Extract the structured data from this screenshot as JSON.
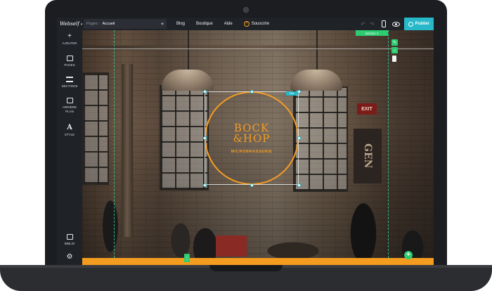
{
  "topbar": {
    "logo": "Webself",
    "pages_label": "Pages :",
    "pages_value": "Accueil",
    "nav": [
      "Blog",
      "Boutique",
      "Aide"
    ],
    "subscribe": "Souscrire",
    "publish": "Publier"
  },
  "sidebar": {
    "items": [
      {
        "label": "AJOUTER",
        "icon": "plus-icon"
      },
      {
        "label": "PAGES",
        "icon": "pages-icon"
      },
      {
        "label": "SECTIONS",
        "icon": "sections-icon"
      },
      {
        "label": "ARRIÈRE PLAN",
        "icon": "background-icon"
      },
      {
        "label": "STYLE",
        "icon": "style-icon"
      },
      {
        "label": "BIBLIO",
        "icon": "library-icon"
      },
      {
        "label": "",
        "icon": "gear-icon"
      }
    ]
  },
  "canvas": {
    "section_tag": "Section 1",
    "type_tag": "Titre",
    "exit_sign": "EXIT",
    "sign_text": "GEN",
    "brand_line1": "BOCK",
    "brand_line2": "&HOP",
    "brand_sub": "MICROBRASSERIE"
  },
  "colors": {
    "accent": "#27b9c9",
    "brand": "#f39c24",
    "editor_green": "#2ecc71",
    "chrome": "#1f2227"
  }
}
